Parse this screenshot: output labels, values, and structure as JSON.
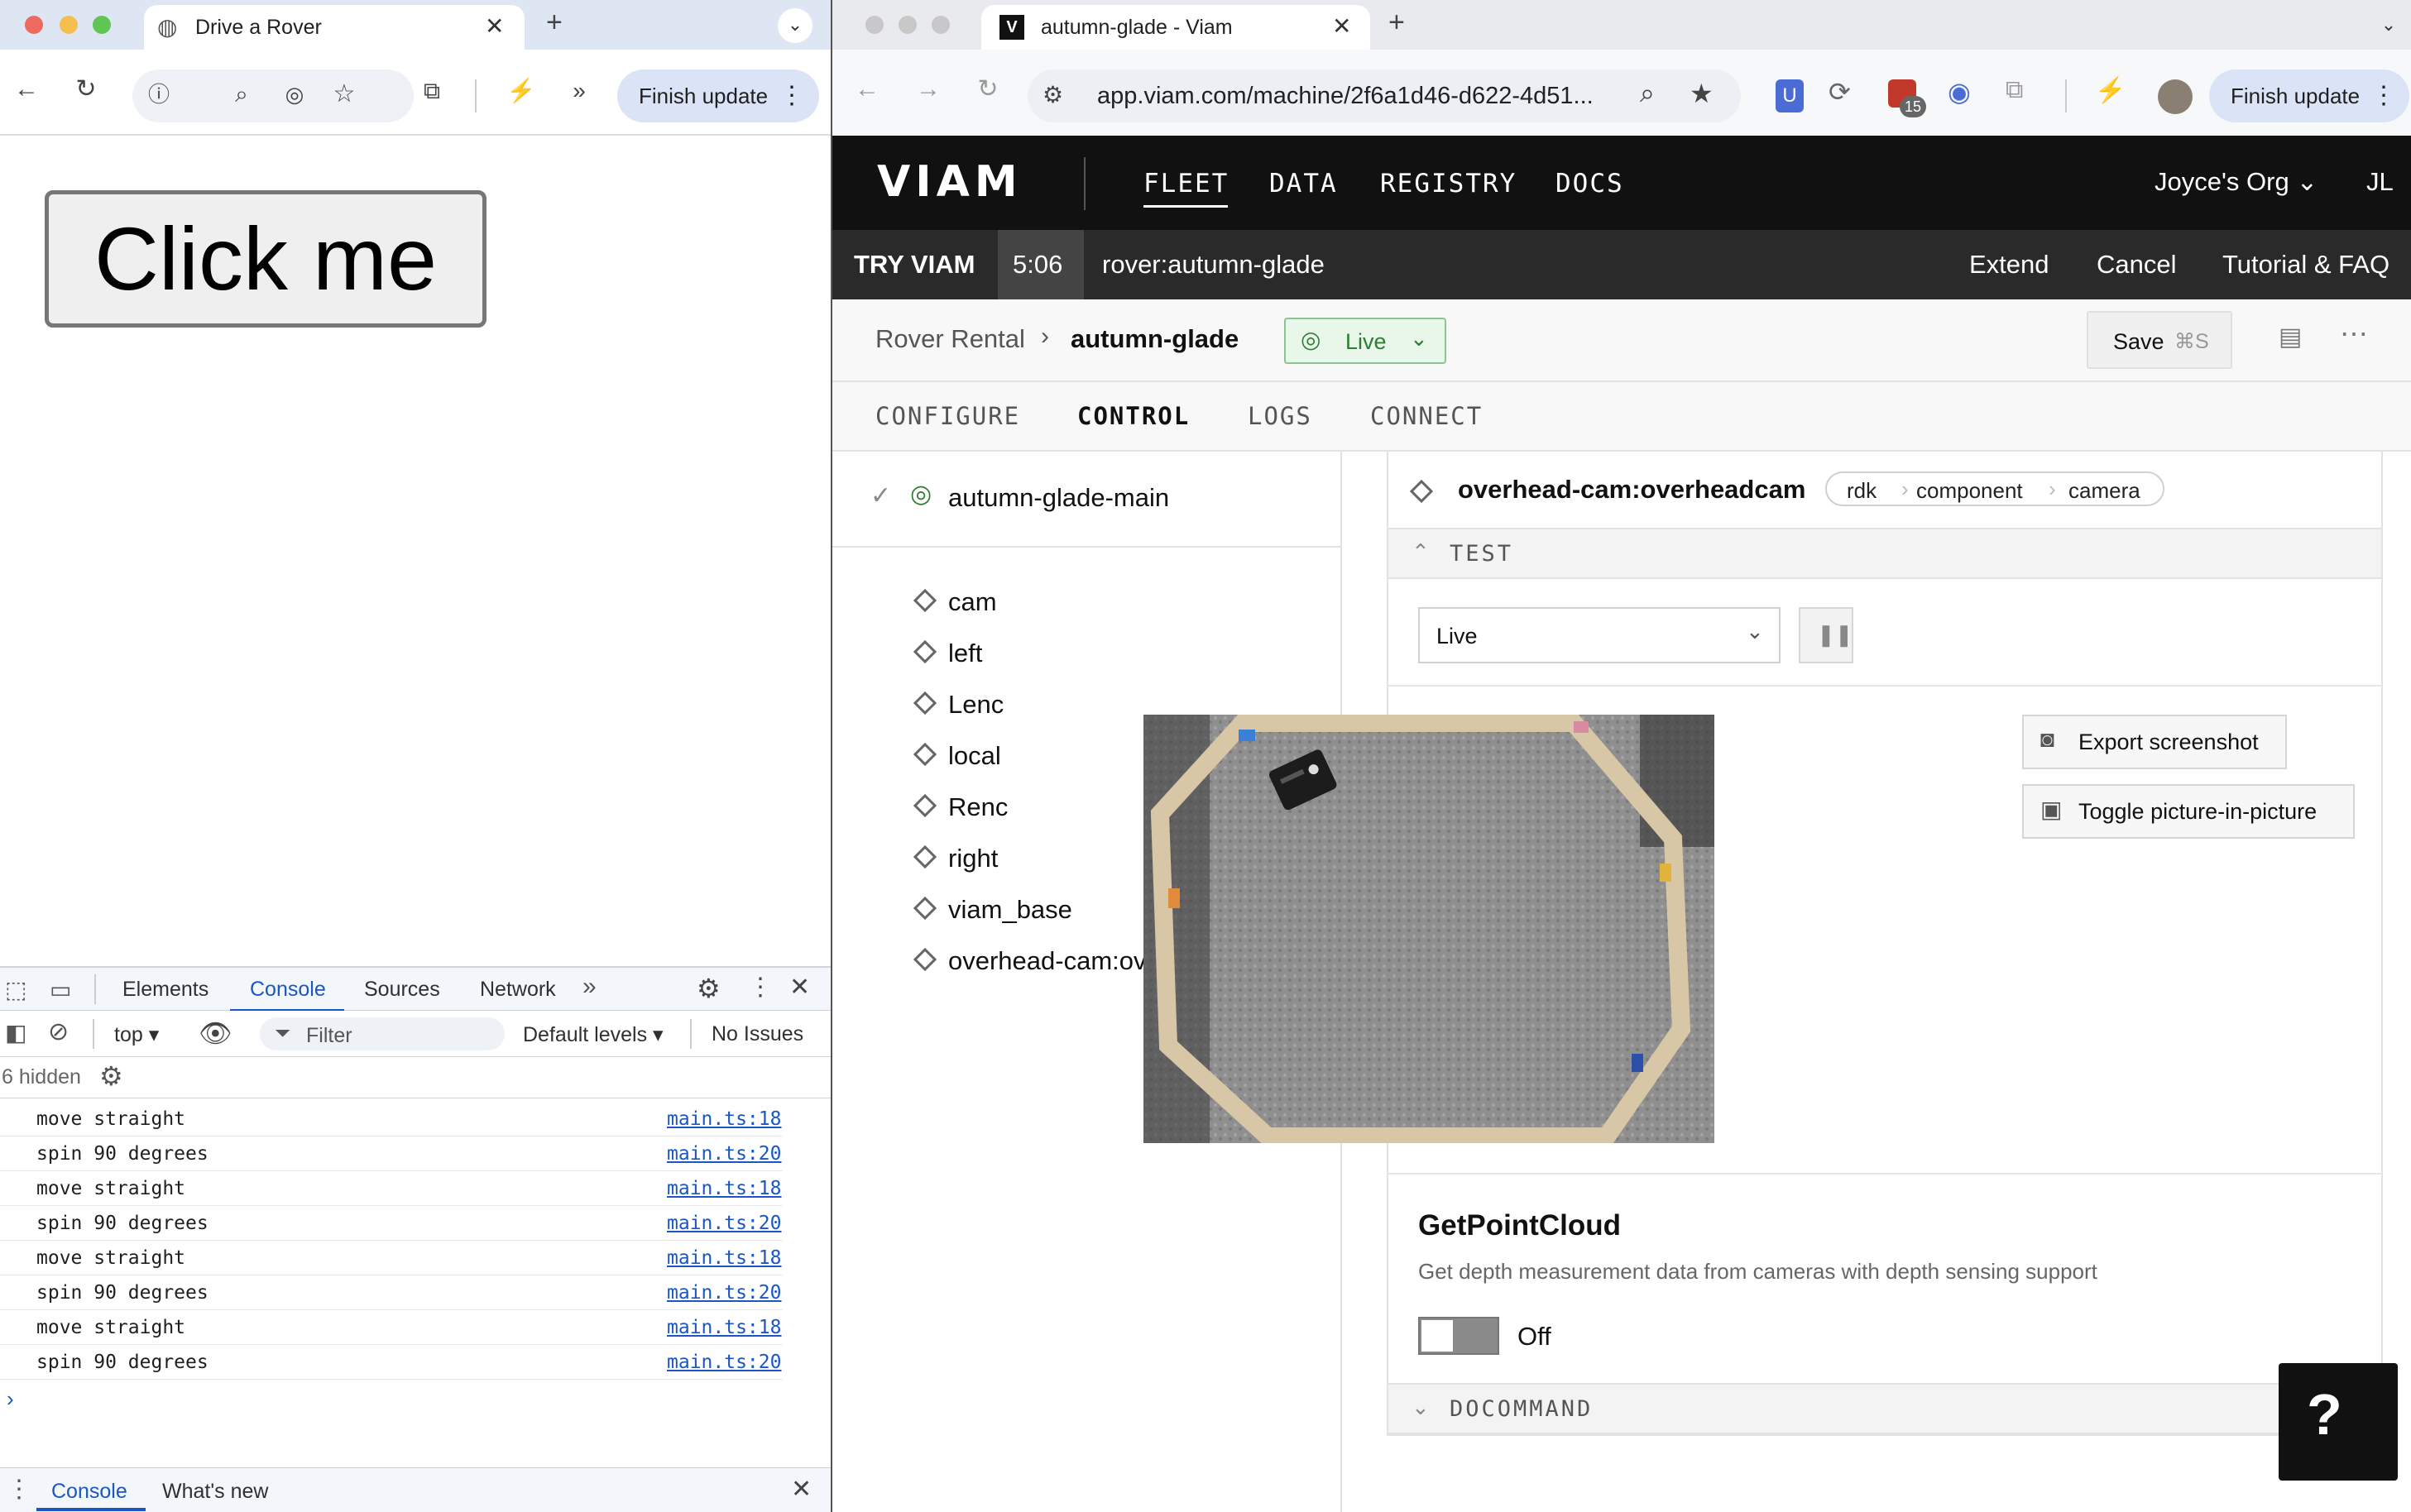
{
  "left_window": {
    "tab_title": "Drive a Rover",
    "finish_update_label": "Finish update",
    "click_button_label": "Click me",
    "devtools": {
      "tabs": [
        "Elements",
        "Console",
        "Sources",
        "Network"
      ],
      "context_label": "top",
      "filter_placeholder": "Filter",
      "levels_label": "Default levels",
      "issues_label": "No Issues",
      "hidden_label": "6 hidden",
      "logs": [
        {
          "message": "move straight",
          "source": "main.ts:18"
        },
        {
          "message": "spin 90 degrees",
          "source": "main.ts:20"
        },
        {
          "message": "move straight",
          "source": "main.ts:18"
        },
        {
          "message": "spin 90 degrees",
          "source": "main.ts:20"
        },
        {
          "message": "move straight",
          "source": "main.ts:18"
        },
        {
          "message": "spin 90 degrees",
          "source": "main.ts:20"
        },
        {
          "message": "move straight",
          "source": "main.ts:18"
        },
        {
          "message": "spin 90 degrees",
          "source": "main.ts:20"
        }
      ],
      "drawer_tabs": [
        "Console",
        "What's new"
      ]
    }
  },
  "right_window": {
    "tab_title": "autumn-glade - Viam",
    "url": "app.viam.com/machine/2f6a1d46-d622-4d51...",
    "extension_badge": "15",
    "finish_update_label": "Finish update",
    "viam": {
      "logo": "VIAM",
      "nav": [
        "FLEET",
        "DATA",
        "REGISTRY",
        "DOCS"
      ],
      "org_label": "Joyce's Org",
      "user_initials": "JL",
      "try_label": "TRY VIAM",
      "timer": "5:06",
      "rover_name": "rover:autumn-glade",
      "try_actions": [
        "Extend",
        "Cancel",
        "Tutorial & FAQ"
      ],
      "breadcrumb_parent": "Rover Rental",
      "breadcrumb_current": "autumn-glade",
      "live_label": "Live",
      "save_label": "Save",
      "save_shortcut": "⌘S",
      "tabs": [
        "CONFIGURE",
        "CONTROL",
        "LOGS",
        "CONNECT"
      ],
      "active_tab": "CONTROL",
      "machine_part": "autumn-glade-main",
      "components": [
        "cam",
        "left",
        "Lenc",
        "local",
        "Renc",
        "right",
        "viam_base",
        "overhead-cam:overheadcam"
      ],
      "card": {
        "title": "overhead-cam:overheadcam",
        "api_path": [
          "rdk",
          "component",
          "camera"
        ],
        "test_label": "TEST",
        "stream_select": "Live",
        "export_label": "Export screenshot",
        "pip_label": "Toggle picture-in-picture",
        "pointcloud_title": "GetPointCloud",
        "pointcloud_desc": "Get depth measurement data from cameras with depth sensing support",
        "toggle_label": "Off",
        "docommand_label": "DOCOMMAND"
      }
    }
  },
  "colors": {
    "live_green": "#2e7d32",
    "link_blue": "#1a56c4",
    "nav_black": "#111111"
  }
}
